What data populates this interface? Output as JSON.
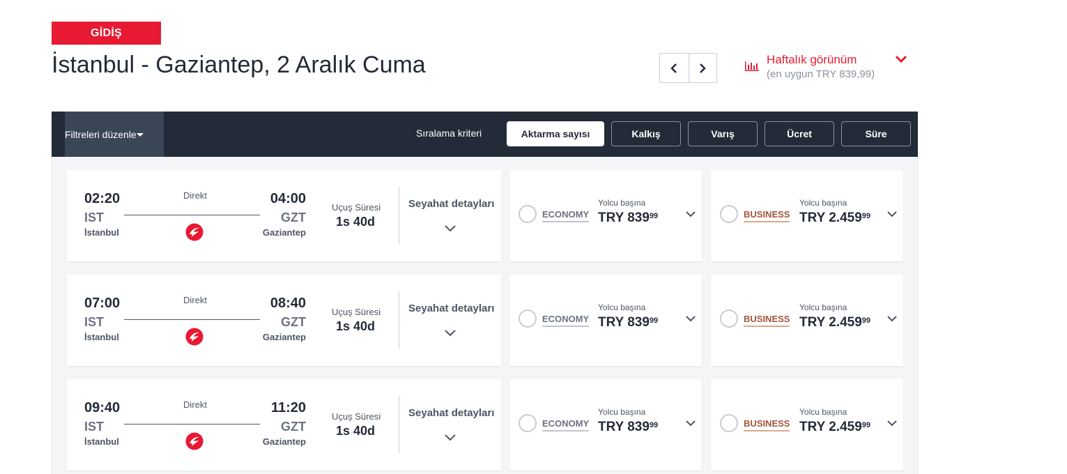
{
  "header": {
    "direction_badge": "GİDİŞ",
    "route_title": "İstanbul - Gaziantep, 2 Aralık Cuma",
    "weekly_view_label": "Haftalık görünüm",
    "weekly_view_sub": "(en uygun TRY 839,99)"
  },
  "toolbar": {
    "filter_label": "Filtreleri düzenle",
    "sort_label": "Sıralama kriteri",
    "sort_options": [
      "Aktarma sayısı",
      "Kalkış",
      "Varış",
      "Ücret",
      "Süre"
    ],
    "active_sort": "Aktarma sayısı"
  },
  "flights": [
    {
      "dep_time": "02:20",
      "dep_code": "IST",
      "dep_city": "İstanbul",
      "arr_time": "04:00",
      "arr_code": "GZT",
      "arr_city": "Gaziantep",
      "stop_type": "Direkt",
      "duration_label": "Uçuş Süresi",
      "duration": "1s 40d",
      "details_label": "Seyahat detayları",
      "economy": {
        "cabin": "ECONOMY",
        "per_passenger": "Yolcu başına",
        "price_main": "TRY 839",
        "price_cents": "99"
      },
      "business": {
        "cabin": "BUSINESS",
        "per_passenger": "Yolcu başına",
        "price_main": "TRY 2.459",
        "price_cents": "99"
      }
    },
    {
      "dep_time": "07:00",
      "dep_code": "IST",
      "dep_city": "İstanbul",
      "arr_time": "08:40",
      "arr_code": "GZT",
      "arr_city": "Gaziantep",
      "stop_type": "Direkt",
      "duration_label": "Uçuş Süresi",
      "duration": "1s 40d",
      "details_label": "Seyahat detayları",
      "economy": {
        "cabin": "ECONOMY",
        "per_passenger": "Yolcu başına",
        "price_main": "TRY 839",
        "price_cents": "99"
      },
      "business": {
        "cabin": "BUSINESS",
        "per_passenger": "Yolcu başına",
        "price_main": "TRY 2.459",
        "price_cents": "99"
      }
    },
    {
      "dep_time": "09:40",
      "dep_code": "IST",
      "dep_city": "İstanbul",
      "arr_time": "11:20",
      "arr_code": "GZT",
      "arr_city": "Gaziantep",
      "stop_type": "Direkt",
      "duration_label": "Uçuş Süresi",
      "duration": "1s 40d",
      "details_label": "Seyahat detayları",
      "economy": {
        "cabin": "ECONOMY",
        "per_passenger": "Yolcu başına",
        "price_main": "TRY 839",
        "price_cents": "99"
      },
      "business": {
        "cabin": "BUSINESS",
        "per_passenger": "Yolcu başına",
        "price_main": "TRY 2.459",
        "price_cents": "99"
      }
    }
  ],
  "colors": {
    "brand_red": "#e81932",
    "toolbar_bg": "#232b38",
    "business_accent": "#a2553a"
  },
  "icons": {
    "prev": "chevron-left-icon",
    "next": "chevron-right-icon",
    "weekly": "bar-chart-icon",
    "airline": "turkish-airlines-logo"
  }
}
